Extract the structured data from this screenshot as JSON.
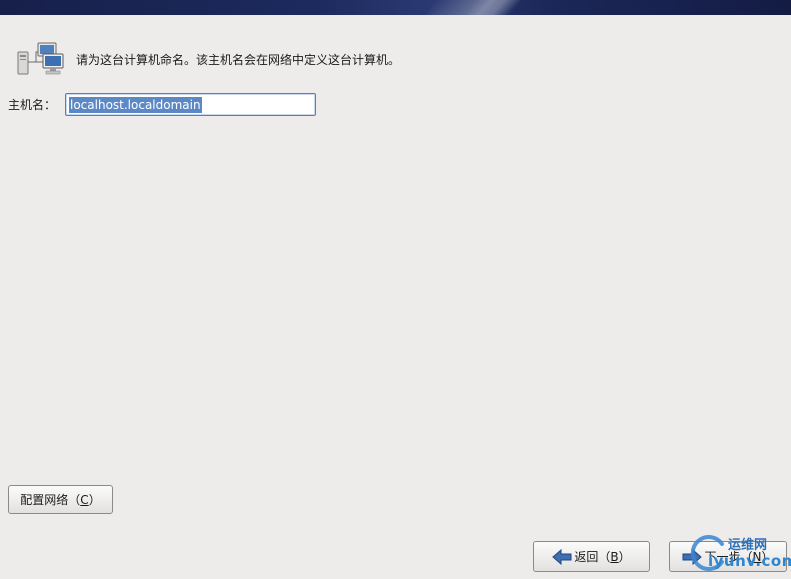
{
  "header": {
    "prompt_text": "请为这台计算机命名。该主机名会在网络中定义这台计算机。"
  },
  "hostname": {
    "label": "主机名：",
    "value": "localhost.localdomain"
  },
  "buttons": {
    "configure_network": {
      "label_prefix": "配置网络（",
      "mnemonic": "C",
      "label_suffix": "）"
    },
    "back": {
      "label_prefix": "返回（",
      "mnemonic": "B",
      "label_suffix": "）"
    },
    "next": {
      "label_prefix": "下一步（",
      "mnemonic": "N",
      "label_suffix": "）"
    }
  },
  "watermark": {
    "top_text": "运维网",
    "bottom_text": "iyunv.com"
  },
  "icons": {
    "header": "network-computers-icon",
    "back": "left-arrow-icon",
    "next": "right-arrow-icon"
  },
  "colors": {
    "banner": "#1c2a5e",
    "selection": "#5d88c6",
    "input_border": "#5b7fb3",
    "background": "#edeceb"
  }
}
